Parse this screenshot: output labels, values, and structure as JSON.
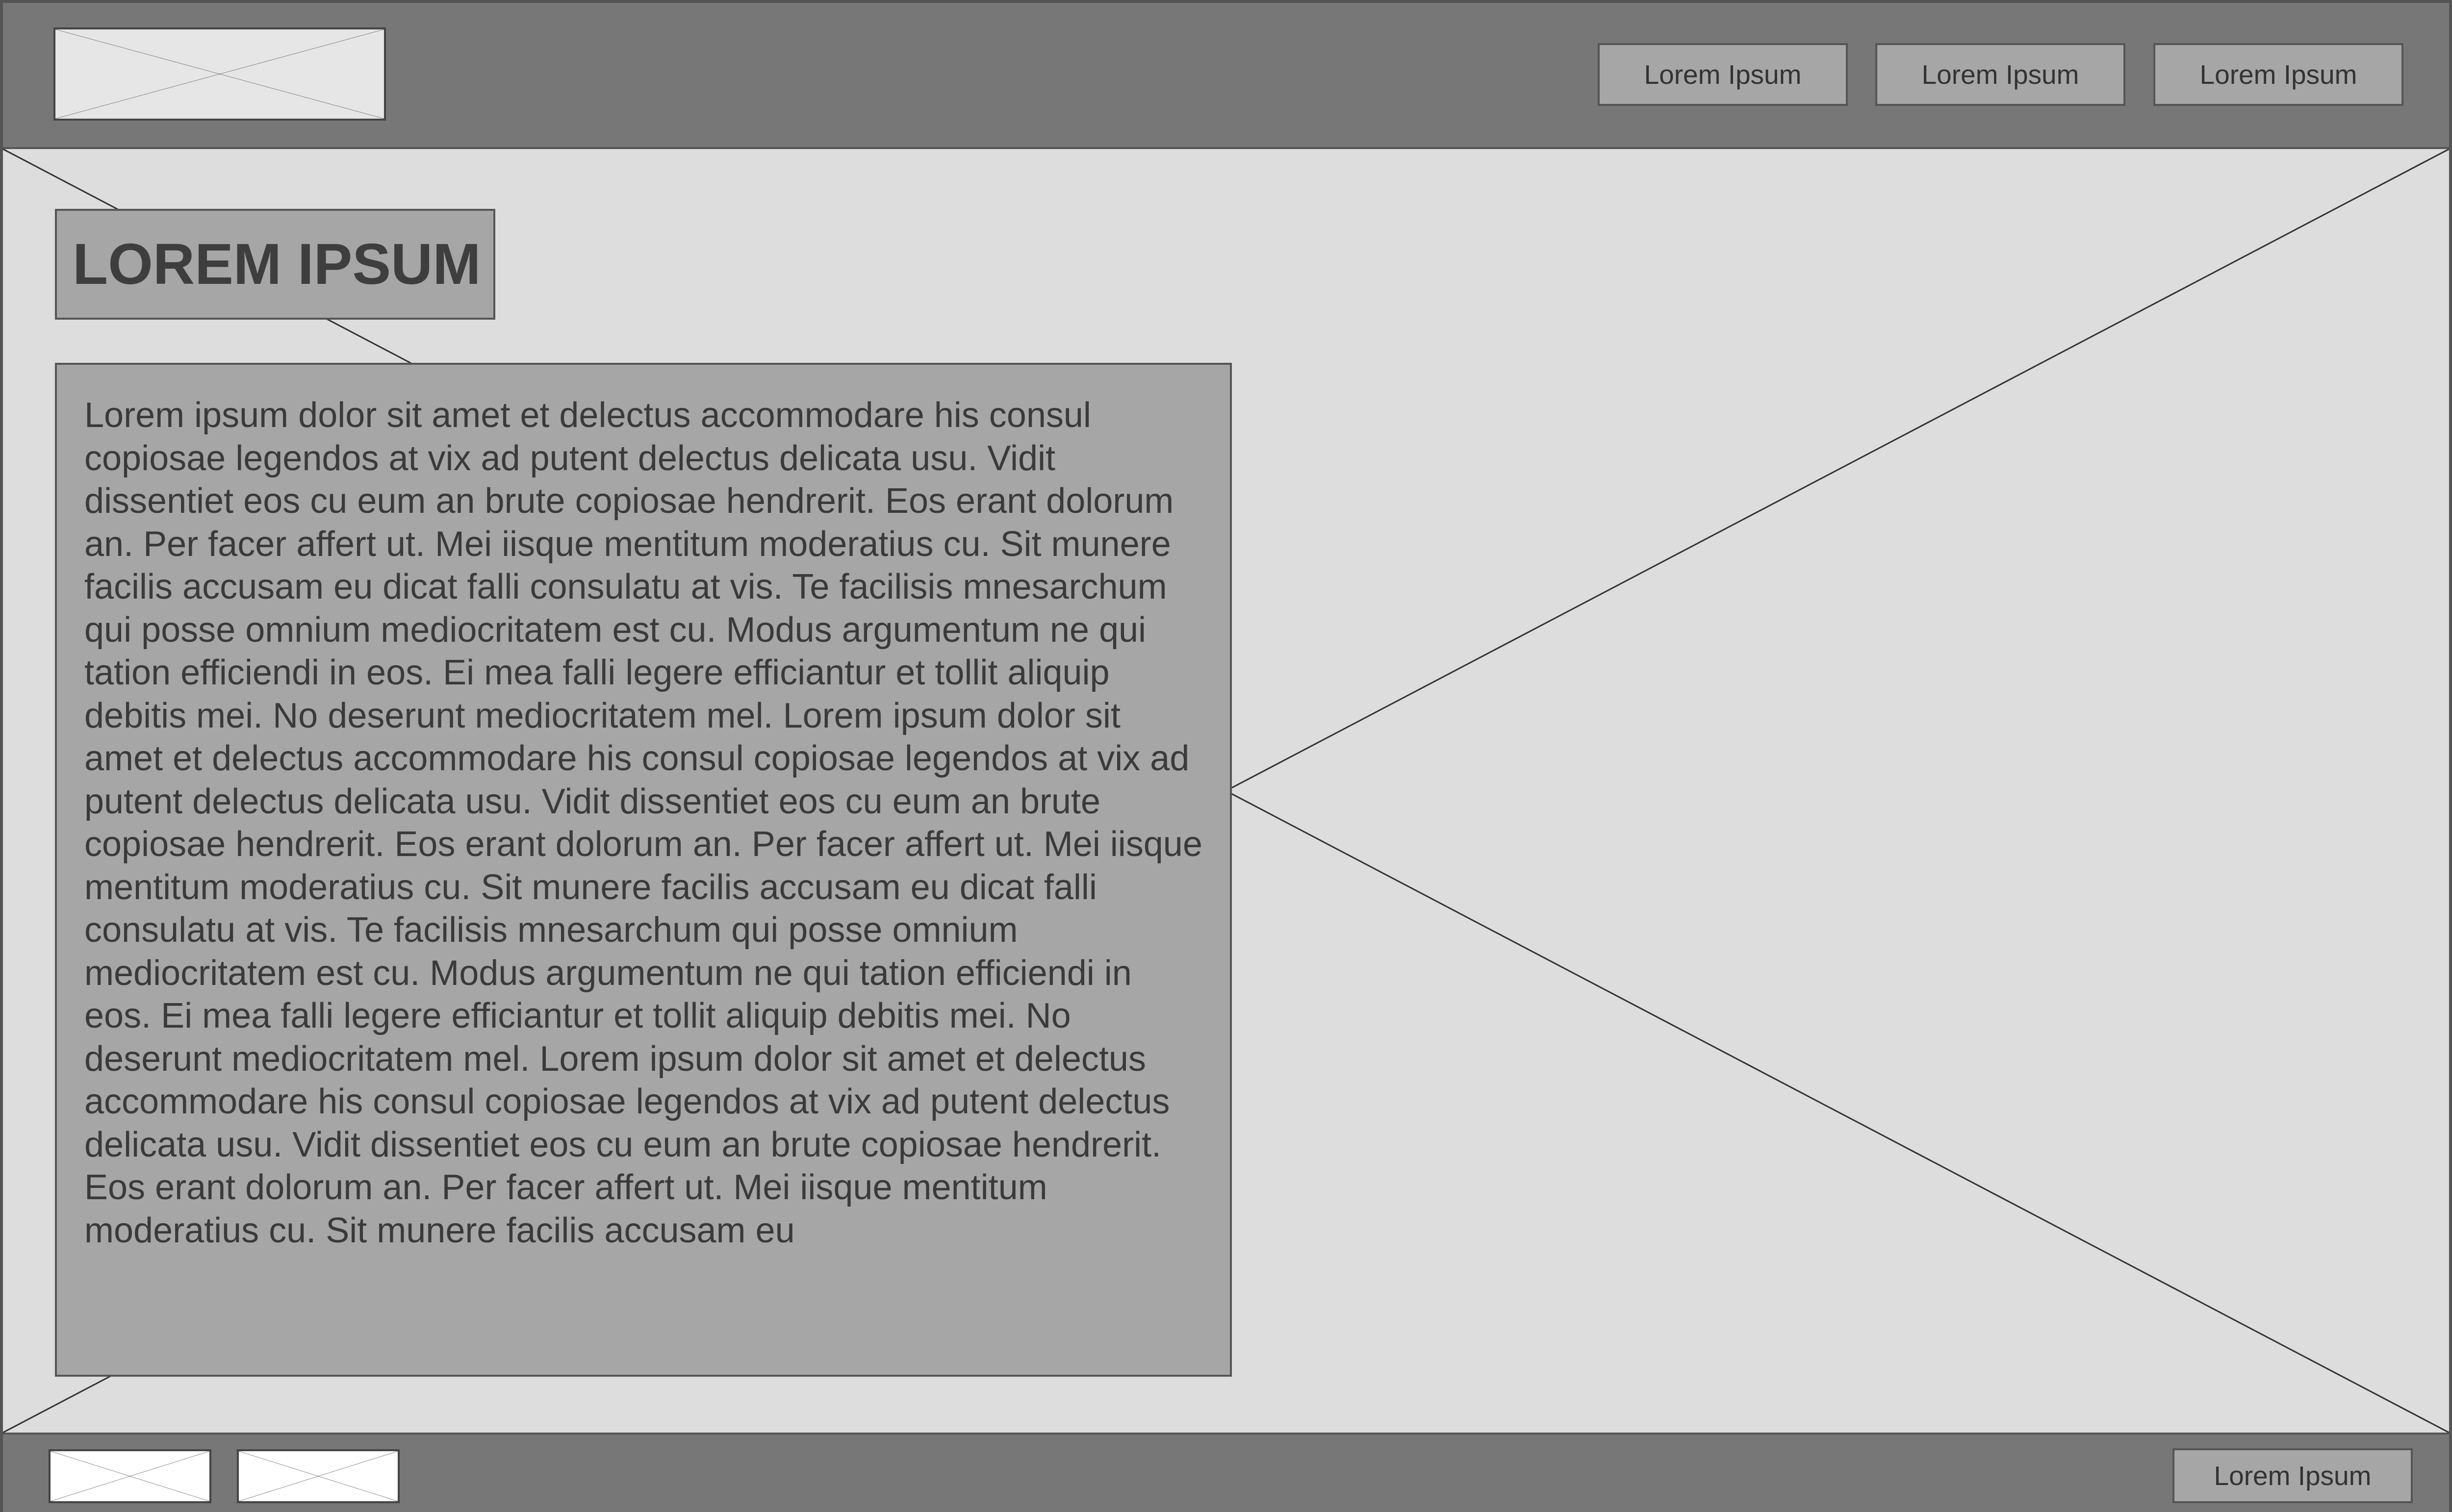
{
  "header": {
    "logo_icon": "image-placeholder-icon",
    "nav": [
      {
        "label": "Lorem Ipsum"
      },
      {
        "label": "Lorem Ipsum"
      },
      {
        "label": "Lorem Ipsum"
      }
    ]
  },
  "hero": {
    "background_icon": "image-placeholder-icon",
    "title": "LOREM IPSUM",
    "body": "Lorem ipsum dolor sit amet et delectus accommodare his consul copiosae legendos at vix ad putent delectus delicata usu. Vidit dissentiet eos cu eum an brute copiosae hendrerit. Eos erant dolorum an. Per facer affert ut. Mei iisque mentitum moderatius cu. Sit munere facilis accusam eu dicat falli consulatu at vis. Te facilisis mnesarchum qui posse omnium mediocritatem est cu. Modus argumentum ne qui tation efficiendi in eos. Ei mea falli legere efficiantur et tollit aliquip debitis mei. No deserunt mediocritatem mel. Lorem ipsum dolor sit amet et delectus accommodare his consul copiosae legendos at vix ad putent delectus delicata usu. Vidit dissentiet eos cu eum an brute copiosae hendrerit. Eos erant dolorum an. Per facer affert ut. Mei iisque mentitum moderatius cu. Sit munere facilis accusam eu dicat falli consulatu at vis. Te facilisis mnesarchum qui posse omnium mediocritatem est cu. Modus argumentum ne qui tation efficiendi in eos. Ei mea falli legere efficiantur et tollit aliquip debitis mei. No deserunt mediocritatem mel. Lorem ipsum dolor sit amet et delectus accommodare his consul copiosae legendos at vix ad putent delectus delicata usu. Vidit dissentiet eos cu eum an brute copiosae hendrerit. Eos erant dolorum an. Per facer affert ut. Mei iisque mentitum moderatius cu. Sit munere facilis accusam eu"
  },
  "footer": {
    "thumbnails": [
      {
        "icon": "image-placeholder-icon"
      },
      {
        "icon": "image-placeholder-icon"
      }
    ],
    "button_label": "Lorem Ipsum"
  },
  "colors": {
    "header_bg": "#777777",
    "page_bg": "#dddddd",
    "box_bg": "#a6a6a6",
    "border": "#555555",
    "text": "#3a3a3a"
  }
}
